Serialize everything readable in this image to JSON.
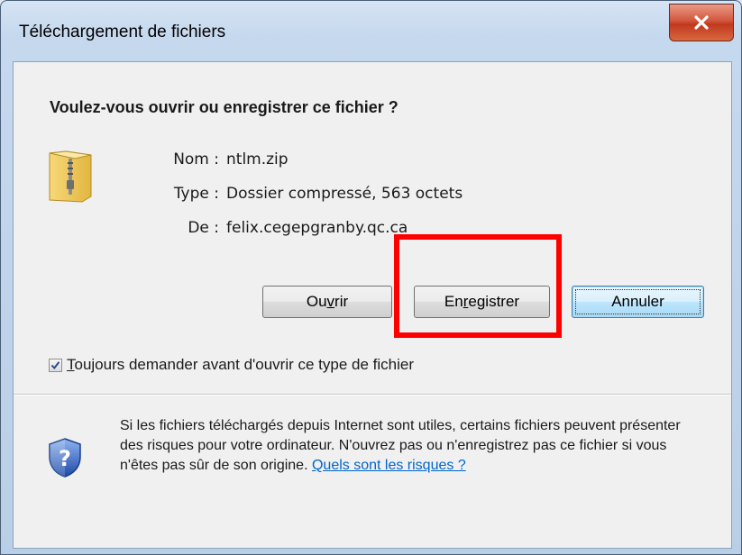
{
  "window": {
    "title": "Téléchargement de fichiers"
  },
  "dialog": {
    "question": "Voulez-vous ouvrir ou enregistrer ce fichier ?",
    "file": {
      "name_label": "Nom :",
      "name_value": "ntlm.zip",
      "type_label": "Type :",
      "type_value": "Dossier compressé, 563 octets",
      "from_label": "De :",
      "from_value": "felix.cegepgranby.qc.ca",
      "icon": "zip-folder-icon"
    },
    "buttons": {
      "open_label_pre": "Ou",
      "open_label_key": "v",
      "open_label_post": "rir",
      "save_label_pre": "En",
      "save_label_key": "r",
      "save_label_post": "egistrer",
      "cancel_label": "Annuler"
    },
    "checkbox": {
      "checked": true,
      "label_key": "T",
      "label_rest": "oujours demander avant d'ouvrir ce type de fichier"
    },
    "warning": {
      "text": "Si les fichiers téléchargés depuis Internet sont utiles, certains fichiers peuvent présenter des risques pour votre ordinateur. N'ouvrez pas ou n'enregistrez pas ce fichier si vous n'êtes pas sûr de son origine. ",
      "link": "Quels sont les risques ?",
      "icon": "shield-question-icon"
    }
  },
  "colors": {
    "highlight": "#ff0000",
    "link": "#0066cc",
    "close_button": "#c7432a"
  }
}
